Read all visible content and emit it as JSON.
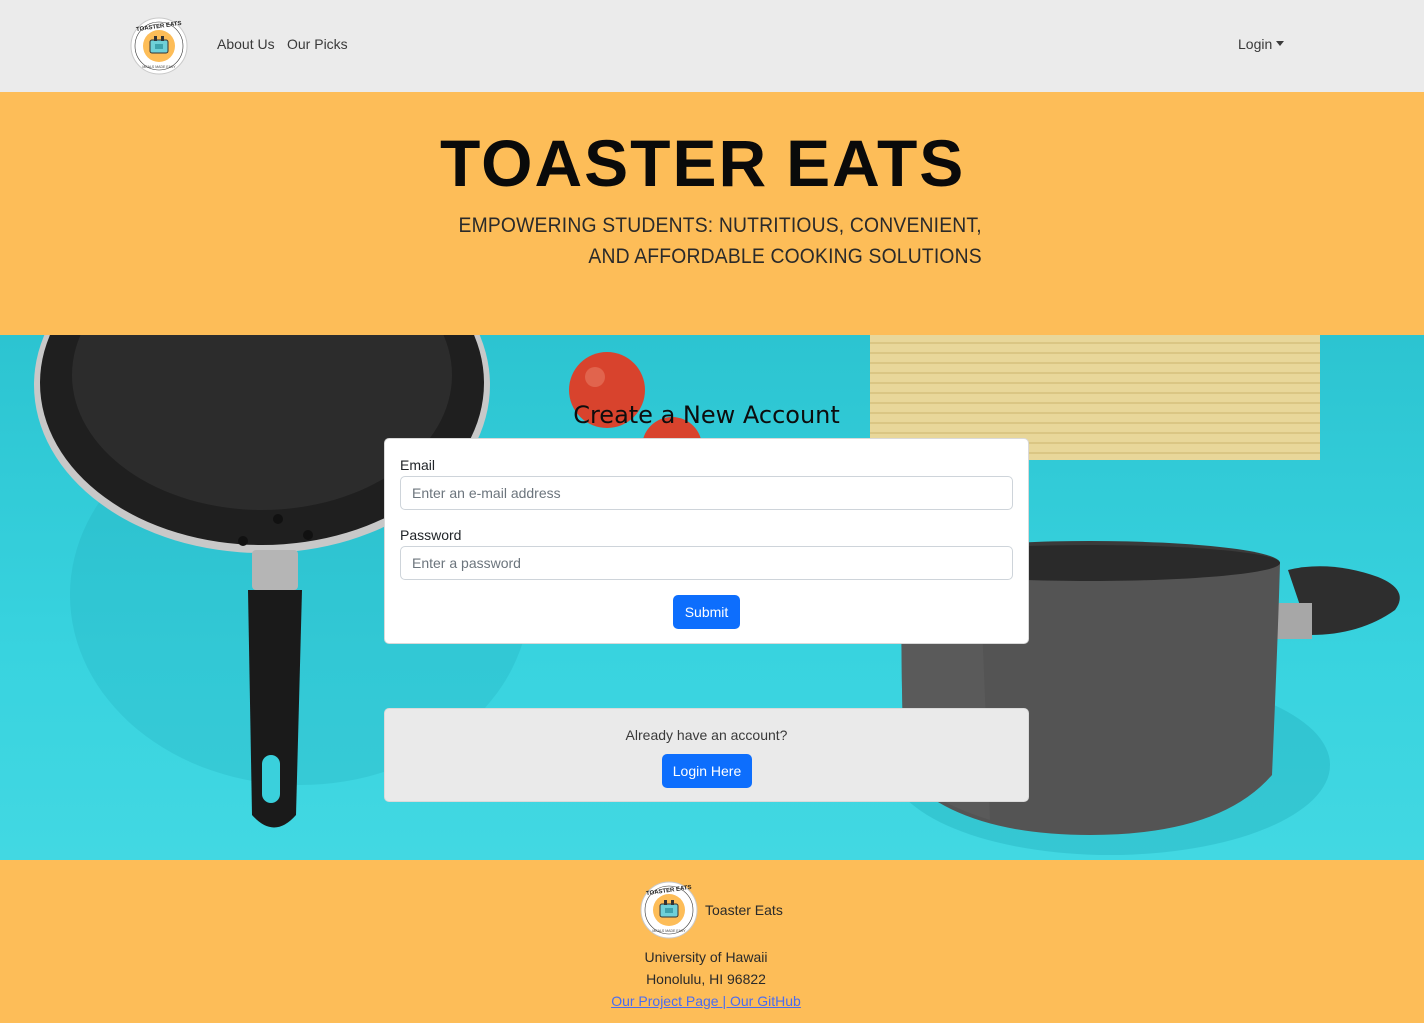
{
  "nav": {
    "about_label": "About Us",
    "picks_label": "Our Picks",
    "login_label": "Login"
  },
  "logo": {
    "top_text": "TOASTER EATS",
    "bottom_text": "MEALS MADE EASY"
  },
  "hero": {
    "title_word1": "TOASTER",
    "title_word2": "EATS",
    "subtitle_line1": "EMPOWERING STUDENTS: NUTRITIOUS, CONVENIENT,",
    "subtitle_line2": "AND AFFORDABLE COOKING SOLUTIONS"
  },
  "form": {
    "title": "Create a New Account",
    "email_label": "Email",
    "email_placeholder": "Enter an e-mail address",
    "email_value": "",
    "password_label": "Password",
    "password_placeholder": "Enter a password",
    "password_value": "",
    "submit_label": "Submit"
  },
  "login_prompt": {
    "text": "Already have an account?",
    "button_label": "Login Here"
  },
  "footer": {
    "brand": "Toaster Eats",
    "university": "University of Hawaii",
    "city": "Honolulu, HI 96822",
    "project_link": "Our Project Page",
    "separator": " | ",
    "github_link": "Our GitHub"
  },
  "colors": {
    "accent_orange": "#fdbd58",
    "primary_blue": "#0d6efd",
    "background_teal": "#38d3df",
    "navbar_gray": "#ebebeb"
  }
}
